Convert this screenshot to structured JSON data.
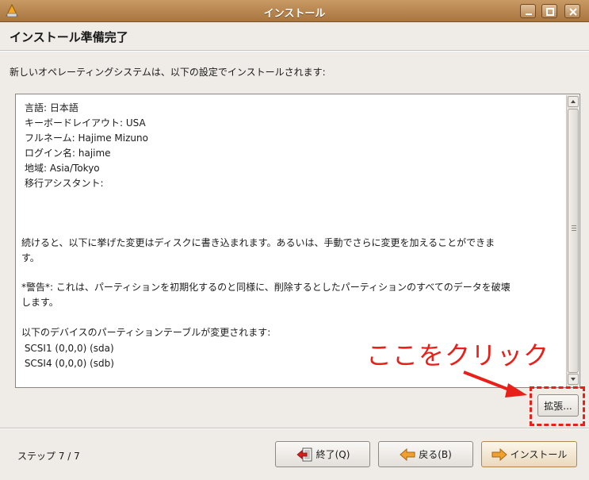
{
  "window": {
    "title": "インストール"
  },
  "heading": "インストール準備完了",
  "intro": "新しいオペレーティングシステムは、以下の設定でインストールされます:",
  "summary_lines": [
    "言語: 日本語",
    "キーボードレイアウト: USA",
    "フルネーム: Hajime Mizuno",
    "ログイン名: hajime",
    "地域: Asia/Tokyo",
    "移行アシスタント:",
    "",
    "",
    "",
    "続けると、以下に挙げた変更はディスクに書き込まれます。あるいは、手動でさらに変更を加えることができま",
    "す。",
    "",
    "*警告*: これは、パーティションを初期化するのと同様に、削除するとしたパーティションのすべてのデータを破壊",
    "します。",
    "",
    "以下のデバイスのパーティションテーブルが変更されます:",
    " SCSI1 (0,0,0) (sda)",
    " SCSI4 (0,0,0) (sdb)"
  ],
  "annotation": "ここをクリック",
  "buttons": {
    "advanced": "拡張...",
    "quit": "終了(Q)",
    "back": "戻る(B)",
    "install": "インストール"
  },
  "step": "ステップ 7 / 7",
  "colors": {
    "annotation": "#e8201a",
    "titlebar": "#b98a58"
  }
}
